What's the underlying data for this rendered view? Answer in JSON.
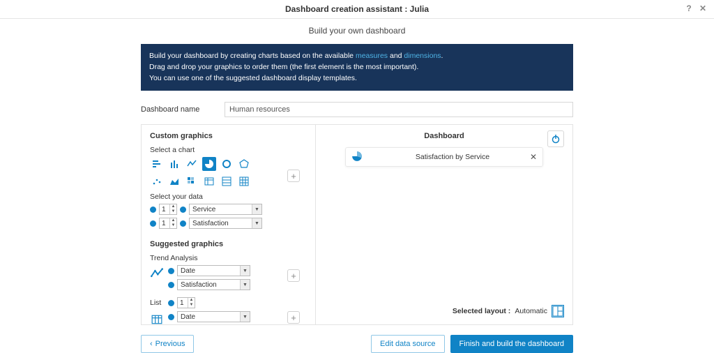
{
  "window": {
    "title": "Dashboard creation assistant : Julia"
  },
  "subtitle": "Build your own dashboard",
  "info": {
    "line1_a": "Build your dashboard by creating charts based on the available ",
    "link_measures": "measures",
    "line1_b": " and ",
    "link_dimensions": "dimensions",
    "line1_c": ".",
    "line2": "Drag and drop your graphics to order them (the first element is the most important).",
    "line3": "You can use one of the suggested dashboard display templates."
  },
  "name_field": {
    "label": "Dashboard name",
    "value": "Human resources"
  },
  "custom": {
    "title": "Custom graphics",
    "select_chart_label": "Select a chart",
    "select_data_label": "Select your data",
    "data_rows": [
      {
        "count": "1",
        "field": "Service"
      },
      {
        "count": "1",
        "field": "Satisfaction"
      }
    ]
  },
  "suggested": {
    "title": "Suggested graphics",
    "trend": {
      "label": "Trend Analysis",
      "rows": [
        {
          "field": "Date"
        },
        {
          "field": "Satisfaction"
        }
      ]
    },
    "list": {
      "label": "List",
      "count": "1",
      "rows": [
        {
          "field": "Date"
        }
      ]
    }
  },
  "dashboard": {
    "title": "Dashboard",
    "card_label": "Satisfaction by Service",
    "layout_label": "Selected layout :",
    "layout_value": "Automatic"
  },
  "footer": {
    "previous": "Previous",
    "edit_source": "Edit data source",
    "finish": "Finish and build the dashboard"
  }
}
